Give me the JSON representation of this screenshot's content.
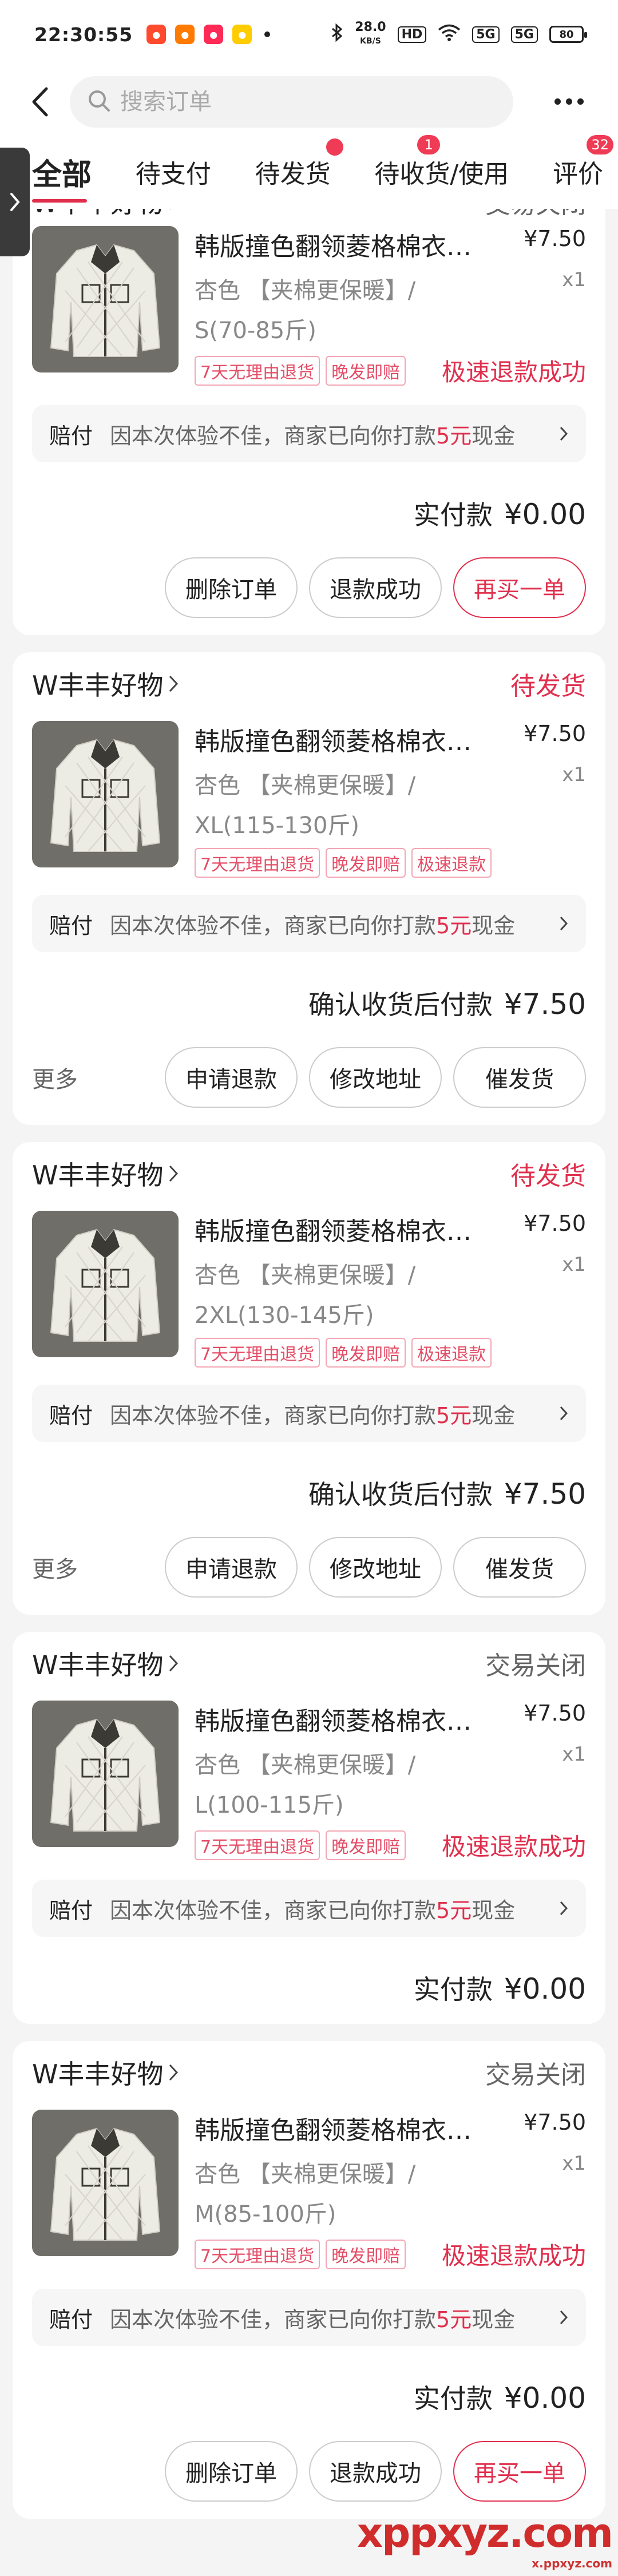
{
  "status_bar": {
    "time": "22:30:55",
    "speed_value": "28.0",
    "speed_unit": "KB/S",
    "hd_label": "HD",
    "signal_labels": [
      "5G",
      "5G"
    ],
    "battery": "80",
    "app_colors": [
      "#ff4a2e",
      "#ff7a00",
      "#ff2a55",
      "#ffcc00"
    ]
  },
  "header": {
    "search_placeholder": "搜索订单"
  },
  "tabs": [
    {
      "label": "全部",
      "active": true,
      "badge": ""
    },
    {
      "label": "待支付",
      "active": false,
      "badge": ""
    },
    {
      "label": "待发货",
      "active": false,
      "badge": "dot"
    },
    {
      "label": "待收货/使用",
      "active": false,
      "badge": "1"
    },
    {
      "label": "评价",
      "active": false,
      "badge": "32"
    }
  ],
  "colors": {
    "accent": "#e0304e",
    "tag_text": "#e44d66"
  },
  "orders": [
    {
      "shop": "W丰丰好物",
      "status": "交易关闭",
      "status_color": "#666666",
      "title": "韩版撞色翻领菱格棉衣…",
      "spec": "杏色 【夹棉更保暖】/ S(70-85斤)",
      "price": "¥7.50",
      "qty": "x1",
      "tags": [
        "7天无理由退货",
        "晚发即赔"
      ],
      "refund_text": "极速退款成功",
      "comp_label": "赔付",
      "comp_text": "因本次体验不佳，商家已向你打款",
      "comp_amount": "5元",
      "comp_suffix": "现金",
      "pay_label": "实付款",
      "pay_amount": "¥0.00",
      "more": "",
      "buttons": [
        "删除订单",
        "退款成功",
        "再买一单"
      ]
    },
    {
      "shop": "W丰丰好物",
      "status": "待发货",
      "status_color": "#e0304e",
      "title": "韩版撞色翻领菱格棉衣…",
      "spec": "杏色 【夹棉更保暖】/ XL(115-130斤)",
      "price": "¥7.50",
      "qty": "x1",
      "tags": [
        "7天无理由退货",
        "晚发即赔",
        "极速退款"
      ],
      "refund_text": "",
      "comp_label": "赔付",
      "comp_text": "因本次体验不佳，商家已向你打款",
      "comp_amount": "5元",
      "comp_suffix": "现金",
      "pay_label": "确认收货后付款",
      "pay_amount": "¥7.50",
      "more": "更多",
      "buttons": [
        "申请退款",
        "修改地址",
        "催发货"
      ]
    },
    {
      "shop": "W丰丰好物",
      "status": "待发货",
      "status_color": "#e0304e",
      "title": "韩版撞色翻领菱格棉衣…",
      "spec": "杏色 【夹棉更保暖】/ 2XL(130-145斤)",
      "price": "¥7.50",
      "qty": "x1",
      "tags": [
        "7天无理由退货",
        "晚发即赔",
        "极速退款"
      ],
      "refund_text": "",
      "comp_label": "赔付",
      "comp_text": "因本次体验不佳，商家已向你打款",
      "comp_amount": "5元",
      "comp_suffix": "现金",
      "pay_label": "确认收货后付款",
      "pay_amount": "¥7.50",
      "more": "更多",
      "buttons": [
        "申请退款",
        "修改地址",
        "催发货"
      ]
    },
    {
      "shop": "W丰丰好物",
      "status": "交易关闭",
      "status_color": "#666666",
      "title": "韩版撞色翻领菱格棉衣…",
      "spec": "杏色 【夹棉更保暖】/ L(100-115斤)",
      "price": "¥7.50",
      "qty": "x1",
      "tags": [
        "7天无理由退货",
        "晚发即赔"
      ],
      "refund_text": "极速退款成功",
      "comp_label": "赔付",
      "comp_text": "因本次体验不佳，商家已向你打款",
      "comp_amount": "5元",
      "comp_suffix": "现金",
      "pay_label": "实付款",
      "pay_amount": "¥0.00",
      "more": "",
      "buttons": []
    },
    {
      "shop": "W丰丰好物",
      "status": "交易关闭",
      "status_color": "#666666",
      "title": "韩版撞色翻领菱格棉衣…",
      "spec": "杏色 【夹棉更保暖】/ M(85-100斤)",
      "price": "¥7.50",
      "qty": "x1",
      "tags": [
        "7天无理由退货",
        "晚发即赔"
      ],
      "refund_text": "极速退款成功",
      "comp_label": "赔付",
      "comp_text": "因本次体验不佳，商家已向你打款",
      "comp_amount": "5元",
      "comp_suffix": "现金",
      "pay_label": "实付款",
      "pay_amount": "¥0.00",
      "more": "",
      "buttons": [
        "删除订单",
        "退款成功",
        "再买一单"
      ]
    }
  ],
  "watermark": {
    "logo": "xppxyz.com",
    "sub": "x.ppxyz.com"
  }
}
